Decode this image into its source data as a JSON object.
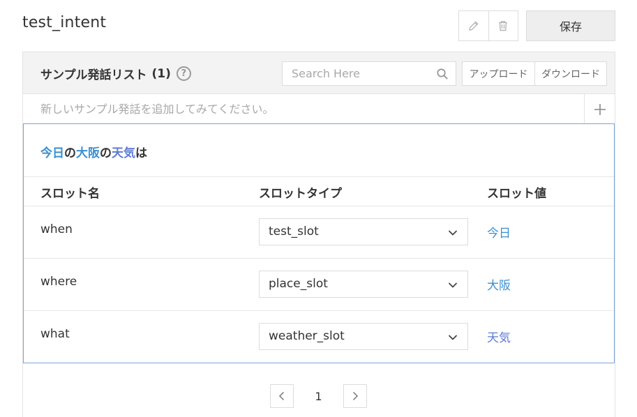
{
  "header": {
    "intent_name": "test_intent",
    "save_label": "保存"
  },
  "panel": {
    "title": "サンプル発話リスト",
    "count": "(1)",
    "help_mark": "?",
    "search_placeholder": "Search Here",
    "upload_label": "アップロード",
    "download_label": "ダウンロード",
    "add_placeholder": "新しいサンプル発話を追加してみてください。"
  },
  "utterance": {
    "segments": [
      {
        "text": "今日",
        "style": "slot",
        "color": "#3a8fd0"
      },
      {
        "text": "の",
        "style": "plain"
      },
      {
        "text": "大阪",
        "style": "slot",
        "color": "#3a8fd0"
      },
      {
        "text": "の",
        "style": "plain"
      },
      {
        "text": "天気",
        "style": "slot",
        "color": "#5e7bd6"
      },
      {
        "text": "は",
        "style": "plain"
      }
    ]
  },
  "slot_table": {
    "headers": {
      "name": "スロット名",
      "type": "スロットタイプ",
      "value": "スロット値"
    },
    "rows": [
      {
        "name": "when",
        "type": "test_slot",
        "value": "今日",
        "value_color": "#3a8fd0"
      },
      {
        "name": "where",
        "type": "place_slot",
        "value": "大阪",
        "value_color": "#3a8fd0"
      },
      {
        "name": "what",
        "type": "weather_slot",
        "value": "天気",
        "value_color": "#5e7bd6"
      }
    ]
  },
  "pagination": {
    "current_page": "1"
  },
  "colors": {
    "accent_blue": "#3a8fd0",
    "accent_purple": "#5e7bd6",
    "selected_border": "#7ea4d6"
  }
}
